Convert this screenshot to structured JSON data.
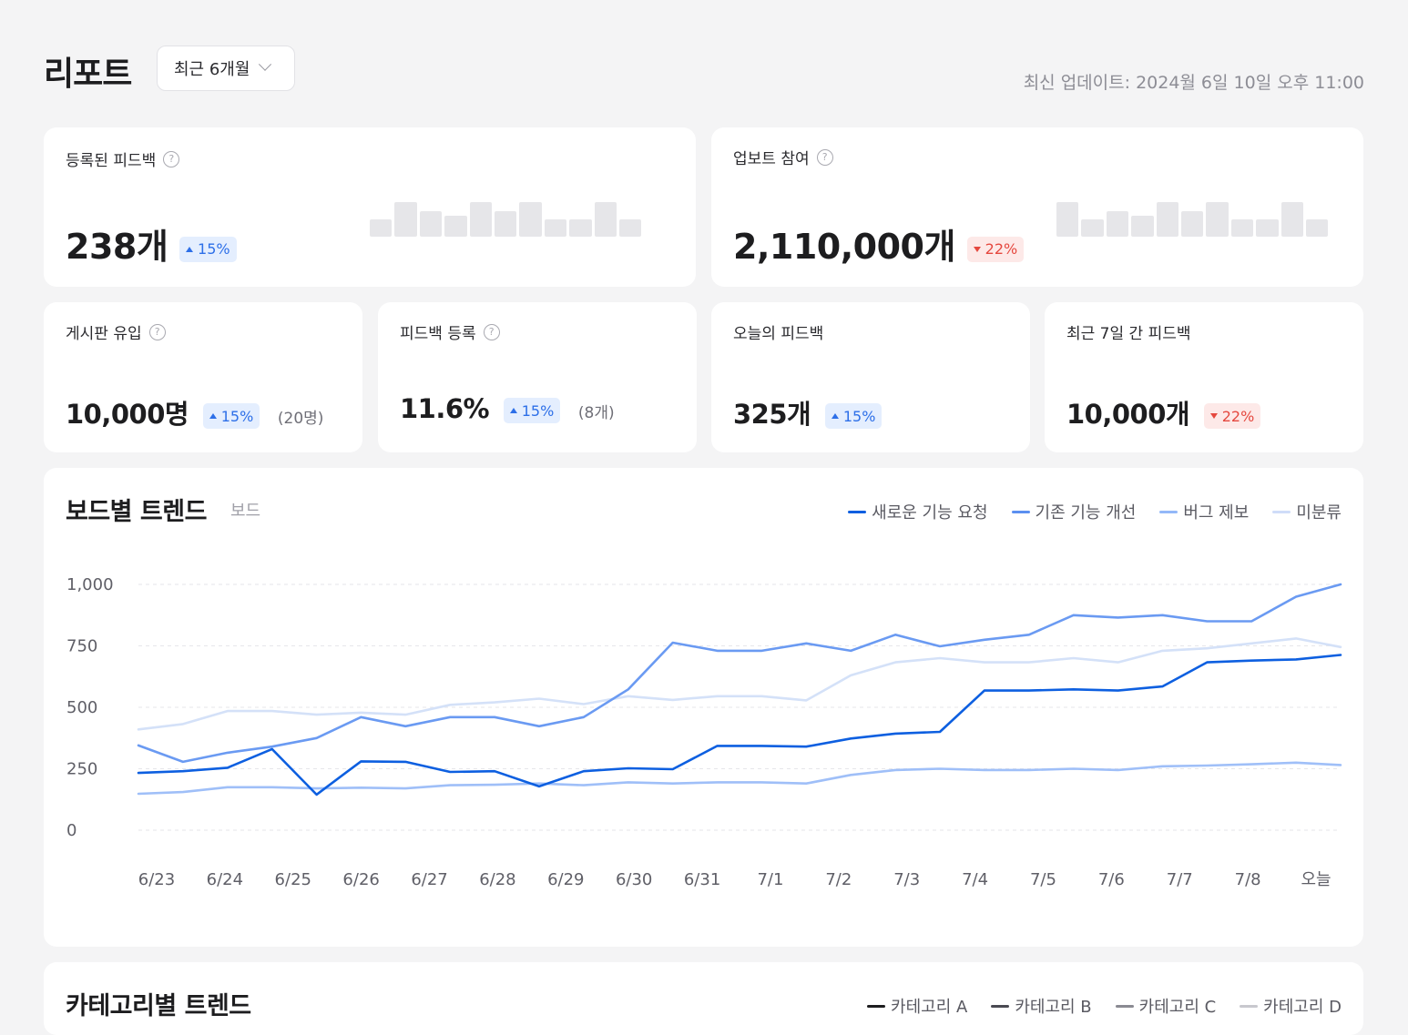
{
  "header": {
    "title": "리포트",
    "period": "최근 6개월",
    "updated": "최신 업데이트: 2024월 6일 10일 오후 11:00"
  },
  "top_cards": [
    {
      "label": "등록된 피드백",
      "value": "238개",
      "change": "15%",
      "direction": "up",
      "sparkline": [
        0.5,
        1,
        0.75,
        0.6,
        1,
        0.75,
        1,
        0.5,
        0.5,
        1,
        0.5
      ]
    },
    {
      "label": "업보트 참여",
      "value": "2,110,000개",
      "change": "22%",
      "direction": "down",
      "sparkline": [
        1,
        0.5,
        0.75,
        0.6,
        1,
        0.75,
        1,
        0.5,
        0.5,
        1,
        0.5
      ]
    }
  ],
  "small_cards": [
    {
      "label": "게시판 유입",
      "value": "10,000명",
      "change": "15%",
      "direction": "up",
      "sub": "(20명)",
      "help": true
    },
    {
      "label": "피드백 등록",
      "value": "11.6%",
      "change": "15%",
      "direction": "up",
      "sub": "(8개)",
      "help": true
    },
    {
      "label": "오늘의 피드백",
      "value": "325개",
      "change": "15%",
      "direction": "up",
      "sub": "",
      "help": false
    },
    {
      "label": "최근 7일 간 피드백",
      "value": "10,000개",
      "change": "22%",
      "direction": "down",
      "sub": "",
      "help": false
    }
  ],
  "board_trend": {
    "title": "보드별 트렌드",
    "subtitle": "보드",
    "legend": [
      {
        "name": "새로운 기능 요청",
        "color": "#0d5fe0"
      },
      {
        "name": "기존 기능 개선",
        "color": "#5b8ff0"
      },
      {
        "name": "버그 제보",
        "color": "#93b8f8"
      },
      {
        "name": "미분류",
        "color": "#cfdcf8"
      }
    ]
  },
  "category_trend": {
    "title": "카테고리별 트렌드",
    "legend": [
      {
        "name": "카테고리 A",
        "color": "#1d1d1f"
      },
      {
        "name": "카테고리 B",
        "color": "#4a4a52"
      },
      {
        "name": "카테고리 C",
        "color": "#8a8a92"
      },
      {
        "name": "카테고리 D",
        "color": "#c8c8ce"
      }
    ]
  },
  "chart_data": {
    "type": "line",
    "title": "보드별 트렌드",
    "x": [
      "6/23",
      "6/24",
      "6/25",
      "6/26",
      "6/27",
      "6/28",
      "6/29",
      "6/30",
      "6/31",
      "7/1",
      "7/2",
      "7/3",
      "7/4",
      "7/5",
      "7/6",
      "7/7",
      "7/8",
      "오늘"
    ],
    "y_ticks": [
      "1,000",
      "750",
      "500",
      "250",
      "0"
    ],
    "ylim": [
      0,
      1000
    ],
    "grid": true,
    "legend_position": "top-right",
    "series": [
      {
        "name": "새로운 기능 요청",
        "color": "#0d5fe0",
        "values": [
          233,
          240,
          254,
          330,
          145,
          280,
          278,
          237,
          240,
          178,
          240,
          252,
          248,
          343,
          343,
          340,
          373,
          393,
          400,
          568,
          568,
          573,
          568,
          585,
          683,
          690,
          695,
          713
        ]
      },
      {
        "name": "기존 기능 개선",
        "color": "#6a9af2",
        "values": [
          345,
          278,
          315,
          340,
          375,
          460,
          423,
          460,
          460,
          423,
          460,
          573,
          763,
          730,
          730,
          760,
          730,
          795,
          748,
          775,
          795,
          875,
          865,
          875,
          850,
          850,
          950,
          1000
        ]
      },
      {
        "name": "버그 제보",
        "color": "#9fbff8",
        "values": [
          148,
          155,
          175,
          175,
          170,
          173,
          170,
          183,
          185,
          190,
          183,
          195,
          190,
          195,
          195,
          190,
          225,
          245,
          250,
          245,
          245,
          250,
          245,
          260,
          263,
          268,
          275,
          265
        ]
      },
      {
        "name": "미분류",
        "color": "#d4e1f8",
        "values": [
          410,
          432,
          485,
          485,
          470,
          478,
          470,
          510,
          520,
          535,
          513,
          545,
          530,
          545,
          545,
          528,
          630,
          683,
          700,
          683,
          683,
          700,
          683,
          730,
          740,
          760,
          780,
          745
        ]
      }
    ]
  }
}
